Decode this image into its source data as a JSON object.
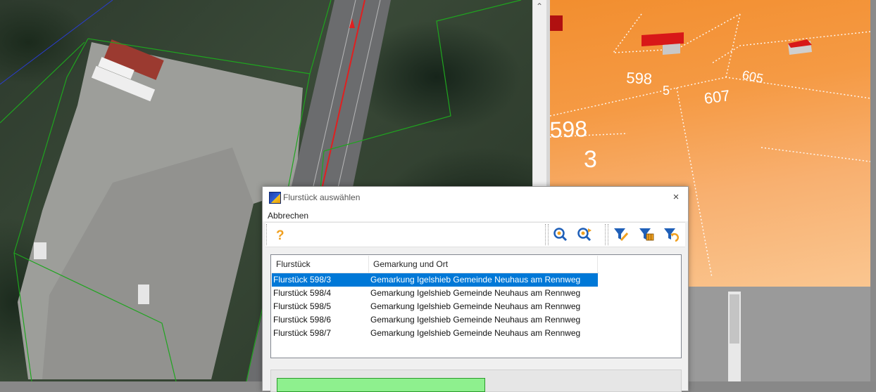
{
  "dialog": {
    "title": "Flurstück auswählen",
    "close_glyph": "×",
    "menu": {
      "cancel_label": "Abbrechen"
    },
    "toolbar": {
      "icons": [
        "help-icon",
        "zoom-to-parcel-icon",
        "zoom-next-icon",
        "filter-edit-icon",
        "filter-table-icon",
        "filter-reset-icon"
      ]
    },
    "list": {
      "columns": [
        "Flurstück",
        "Gemarkung und Ort"
      ],
      "rows": [
        {
          "parcel": "Flurstück 598/3",
          "location": "Gemarkung Igelshieb Gemeinde Neuhaus am Rennweg",
          "selected": true
        },
        {
          "parcel": "Flurstück 598/4",
          "location": "Gemarkung Igelshieb Gemeinde Neuhaus am Rennweg",
          "selected": false
        },
        {
          "parcel": "Flurstück 598/5",
          "location": "Gemarkung Igelshieb Gemeinde Neuhaus am Rennweg",
          "selected": false
        },
        {
          "parcel": "Flurstück 598/6",
          "location": "Gemarkung Igelshieb Gemeinde Neuhaus am Rennweg",
          "selected": false
        },
        {
          "parcel": "Flurstück 598/7",
          "location": "Gemarkung Igelshieb Gemeinde Neuhaus am Rennweg",
          "selected": false
        }
      ]
    },
    "progress_fraction": 0.52
  },
  "view3d": {
    "labels": [
      "598",
      "605",
      "607",
      "598",
      "3",
      "5"
    ]
  },
  "colors": {
    "selection": "#0078d7",
    "parcel_lines": "#1fa51f",
    "road_line": "#e02020",
    "terrain": "#f5a050",
    "buildings": "#d81818",
    "icon_blue": "#1f5fb8",
    "icon_orange": "#f0a020"
  }
}
